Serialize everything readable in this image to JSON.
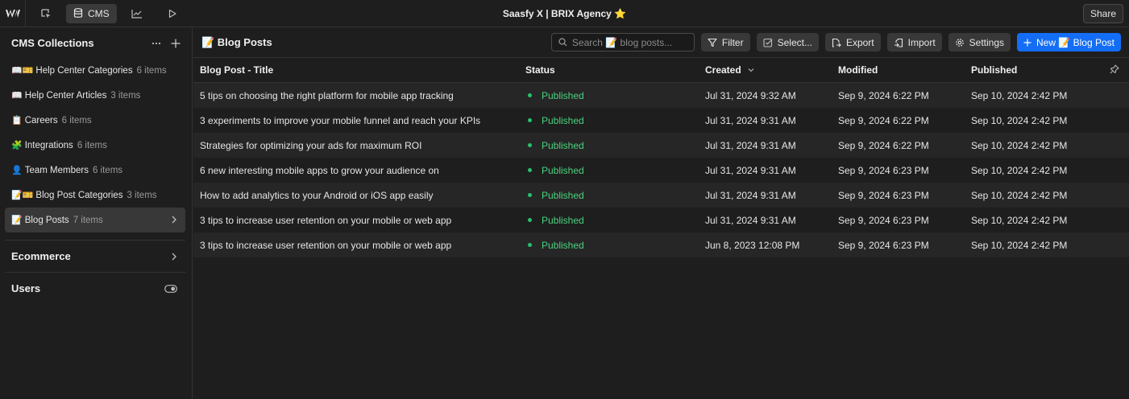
{
  "topbar": {
    "title": "Saasfy X | BRIX Agency ⭐",
    "cms_label": "CMS",
    "share_label": "Share"
  },
  "sidebar": {
    "title": "CMS Collections",
    "items": [
      {
        "emoji": "📖🎫",
        "label": "Help Center Categories",
        "count": "6 items"
      },
      {
        "emoji": "📖",
        "label": "Help Center Articles",
        "count": "3 items"
      },
      {
        "emoji": "📋",
        "label": "Careers",
        "count": "6 items"
      },
      {
        "emoji": "🧩",
        "label": "Integrations",
        "count": "6 items"
      },
      {
        "emoji": "👤",
        "label": "Team Members",
        "count": "6 items"
      },
      {
        "emoji": "📝🎫",
        "label": "Blog Post Categories",
        "count": "3 items"
      },
      {
        "emoji": "📝",
        "label": "Blog Posts",
        "count": "7 items"
      }
    ],
    "ecommerce_label": "Ecommerce",
    "users_label": "Users"
  },
  "main": {
    "title": "📝 Blog Posts",
    "search_placeholder": "Search 📝 blog posts...",
    "toolbar": {
      "filter": "Filter",
      "select": "Select...",
      "export": "Export",
      "import": "Import",
      "settings": "Settings",
      "new_post": "New 📝 Blog Post"
    },
    "columns": {
      "title": "Blog Post - Title",
      "status": "Status",
      "created": "Created",
      "modified": "Modified",
      "published": "Published"
    },
    "rows": [
      {
        "title": "5 tips on choosing the right platform for mobile app tracking",
        "status": "Published",
        "created": "Jul 31, 2024 9:32 AM",
        "modified": "Sep 9, 2024 6:22 PM",
        "published": "Sep 10, 2024 2:42 PM"
      },
      {
        "title": "3 experiments to improve your mobile funnel and reach your KPIs",
        "status": "Published",
        "created": "Jul 31, 2024 9:31 AM",
        "modified": "Sep 9, 2024 6:22 PM",
        "published": "Sep 10, 2024 2:42 PM"
      },
      {
        "title": "Strategies for optimizing your ads for maximum ROI",
        "status": "Published",
        "created": "Jul 31, 2024 9:31 AM",
        "modified": "Sep 9, 2024 6:22 PM",
        "published": "Sep 10, 2024 2:42 PM"
      },
      {
        "title": "6 new interesting mobile apps to grow your audience on",
        "status": "Published",
        "created": "Jul 31, 2024 9:31 AM",
        "modified": "Sep 9, 2024 6:23 PM",
        "published": "Sep 10, 2024 2:42 PM"
      },
      {
        "title": "How to add analytics to your Android or iOS app easily",
        "status": "Published",
        "created": "Jul 31, 2024 9:31 AM",
        "modified": "Sep 9, 2024 6:23 PM",
        "published": "Sep 10, 2024 2:42 PM"
      },
      {
        "title": "3 tips to increase user retention on your mobile or web app",
        "status": "Published",
        "created": "Jul 31, 2024 9:31 AM",
        "modified": "Sep 9, 2024 6:23 PM",
        "published": "Sep 10, 2024 2:42 PM"
      },
      {
        "title": "3 tips to increase user retention on your mobile or web app",
        "status": "Published",
        "created": "Jun 8, 2023 12:08 PM",
        "modified": "Sep 9, 2024 6:23 PM",
        "published": "Sep 10, 2024 2:42 PM"
      }
    ]
  },
  "colors": {
    "accent": "#146ef5",
    "published_green": "#4ad37e",
    "background": "#1e1e1e"
  }
}
